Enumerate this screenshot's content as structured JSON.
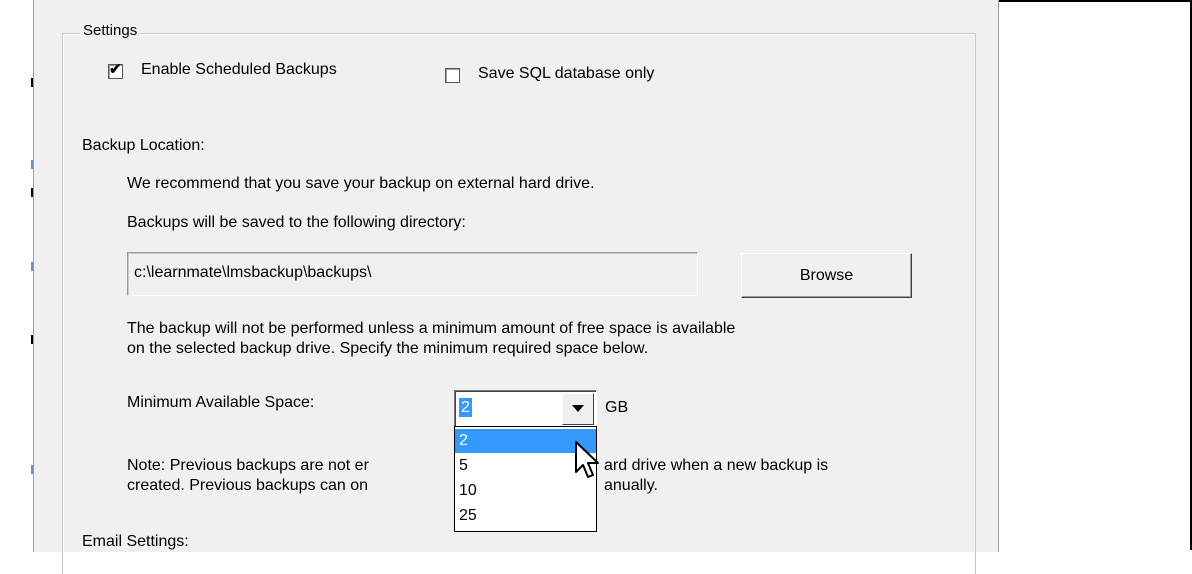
{
  "settings": {
    "legend": "Settings",
    "enable_scheduled_backups": {
      "label": "Enable Scheduled Backups",
      "checked": true
    },
    "save_sql_only": {
      "label": "Save SQL database only",
      "checked": false
    }
  },
  "backup_location": {
    "heading": "Backup Location:",
    "recommend_text": "We recommend that you save your backup on external hard drive.",
    "directory_caption": "Backups will be saved to the following directory:",
    "directory_value": "c:\\learnmate\\lmsbackup\\backups\\",
    "browse_label": "Browse",
    "free_space_line1": "The backup will not be performed unless a minimum amount of free space is available",
    "free_space_line2": "on the selected backup drive. Specify the minimum required space below.",
    "min_space_label": "Minimum Available Space:",
    "min_space_value": "2",
    "unit": "GB",
    "options": [
      "2",
      "5",
      "10",
      "25"
    ],
    "note_line1_start": "Note: Previous backups are not er",
    "note_line1_end": "ard drive when a new backup is",
    "note_line2_start": "created. Previous backups can on",
    "note_line2_end": "anually."
  },
  "email_settings": {
    "heading": "Email Settings:"
  }
}
